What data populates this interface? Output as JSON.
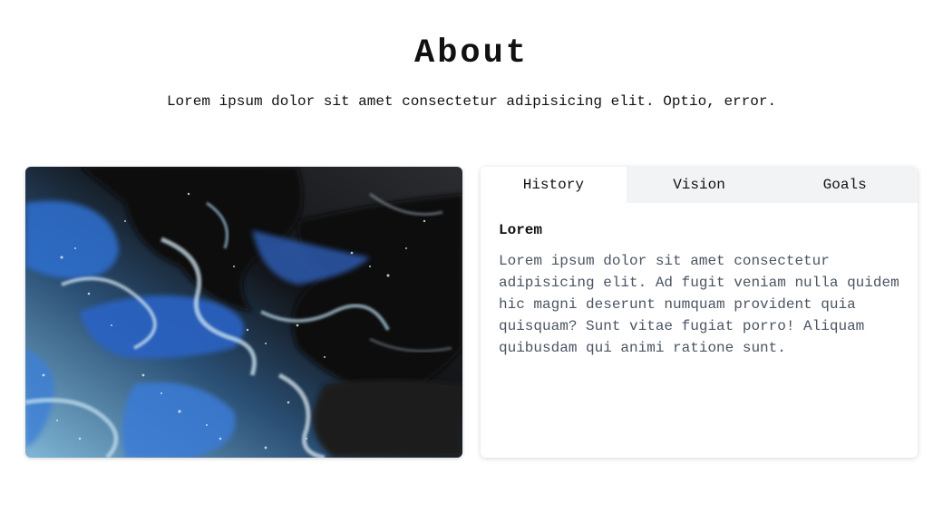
{
  "header": {
    "title": "About",
    "subtitle": "Lorem ipsum dolor sit amet consectetur adipisicing elit. Optio, error."
  },
  "image": {
    "icon": "abstract-fluid-art-image"
  },
  "tabs": [
    {
      "label": "History",
      "active": true
    },
    {
      "label": "Vision",
      "active": false
    },
    {
      "label": "Goals",
      "active": false
    }
  ],
  "panel": {
    "heading": "Lorem",
    "body": "Lorem ipsum dolor sit amet consectetur adipisicing elit. Ad fugit veniam nulla quidem hic magni deserunt numquam provident quia quisquam? Sunt vitae fugiat porro! Aliquam quibusdam qui animi ratione sunt."
  },
  "colors": {
    "tab_inactive_bg": "#f2f3f5",
    "tab_active_bg": "#ffffff",
    "body_text": "#4b5563",
    "art_blue": "#2f6fd0",
    "art_light_blue": "#8ec3e0",
    "art_dark": "#111111"
  }
}
